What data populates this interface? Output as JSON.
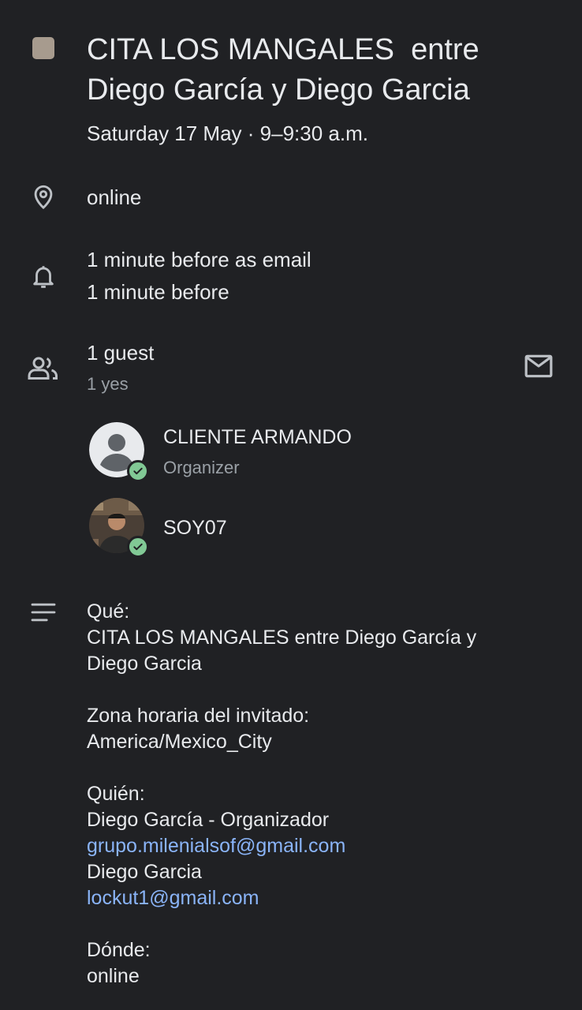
{
  "event": {
    "color": "#a79b8e",
    "title": "CITA LOS MANGALES  entre Diego García y Diego Garcia",
    "datetime": "Saturday 17 May · 9–9:30 a.m."
  },
  "location": {
    "icon": "location-pin-icon",
    "text": "online"
  },
  "notifications": {
    "icon": "bell-icon",
    "items": [
      "1 minute before as email",
      "1 minute before"
    ]
  },
  "guests": {
    "icon": "people-icon",
    "summary": "1 guest",
    "responses": "1 yes",
    "email_icon": "email-icon",
    "list": [
      {
        "name": "CLIENTE ARMANDO",
        "role": "Organizer",
        "avatar": "default-person-avatar"
      },
      {
        "name": "SOY07",
        "role": "",
        "avatar": "photo-avatar"
      }
    ]
  },
  "description": {
    "icon": "notes-icon",
    "lines": [
      {
        "text": "Qué:",
        "type": "text"
      },
      {
        "text": "CITA LOS MANGALES  entre Diego García y",
        "type": "text"
      },
      {
        "text": "Diego Garcia",
        "type": "text"
      },
      {
        "text": "",
        "type": "blank"
      },
      {
        "text": "Zona horaria del invitado:",
        "type": "text"
      },
      {
        "text": "America/Mexico_City",
        "type": "text"
      },
      {
        "text": "",
        "type": "blank"
      },
      {
        "text": "Quién:",
        "type": "text"
      },
      {
        "text": "Diego García - Organizador",
        "type": "text"
      },
      {
        "text": "grupo.milenialsof@gmail.com",
        "type": "link"
      },
      {
        "text": "Diego Garcia",
        "type": "text"
      },
      {
        "text": "lockut1@gmail.com",
        "type": "link"
      },
      {
        "text": "",
        "type": "blank"
      },
      {
        "text": "Dónde:",
        "type": "text"
      },
      {
        "text": "online",
        "type": "text"
      }
    ]
  },
  "colors": {
    "background": "#202124",
    "text": "#e8eaed",
    "secondary_text": "#9aa0a6",
    "link": "#8ab4f8",
    "accept_badge": "#81c995"
  }
}
